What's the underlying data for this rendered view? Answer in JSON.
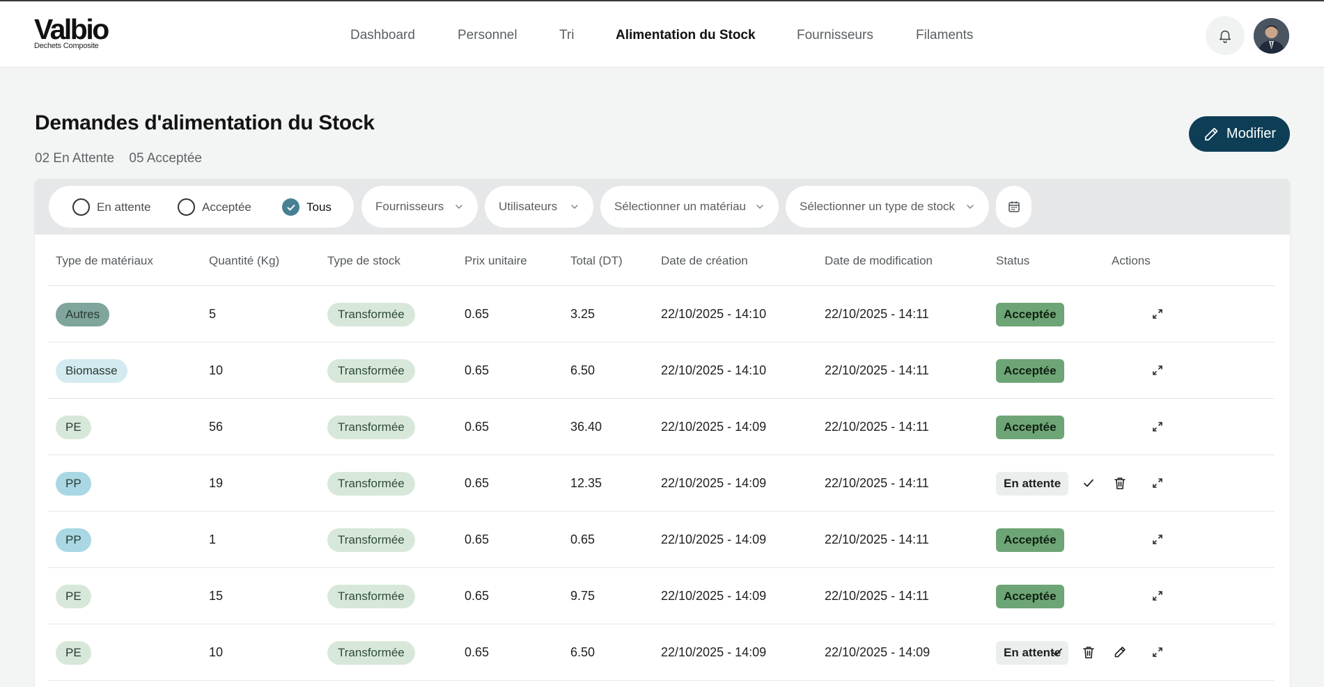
{
  "brand": {
    "name": "Valbio",
    "tagline": "Dechets Composite"
  },
  "nav": [
    {
      "label": "Dashboard",
      "active": false
    },
    {
      "label": "Personnel",
      "active": false
    },
    {
      "label": "Tri",
      "active": false
    },
    {
      "label": "Alimentation du Stock",
      "active": true
    },
    {
      "label": "Fournisseurs",
      "active": false
    },
    {
      "label": "Filaments",
      "active": false
    }
  ],
  "header_icons": {
    "notifications": "bell-icon",
    "avatar": "user-avatar"
  },
  "page": {
    "title": "Demandes d'alimentation du Stock",
    "count_pending": "02 En Attente",
    "count_accepted": "05 Acceptée",
    "modify_label": "Modifier"
  },
  "filters": {
    "status_options": [
      {
        "label": "En attente",
        "checked": false
      },
      {
        "label": "Acceptée",
        "checked": false
      },
      {
        "label": "Tous",
        "checked": true
      }
    ],
    "suppliers": "Fournisseurs",
    "users": "Utilisateurs",
    "material": "Sélectionner un matériau",
    "stock_type": "Sélectionner un type de stock",
    "date_icon": "calendar-icon"
  },
  "table": {
    "headers": [
      "Type de matériaux",
      "Quantité (Kg)",
      "Type de stock",
      "Prix unitaire",
      "Total (DT)",
      "Date de création",
      "Date de modification",
      "Status",
      "Actions"
    ],
    "rows": [
      {
        "material": "Autres",
        "qty": "5",
        "stock": "Transformée",
        "price": "0.65",
        "total": "3.25",
        "created": "22/10/2025 - 14:10",
        "modified": "22/10/2025 - 14:11",
        "status": "Acceptée",
        "actions": [
          "expand"
        ]
      },
      {
        "material": "Biomasse",
        "qty": "10",
        "stock": "Transformée",
        "price": "0.65",
        "total": "6.50",
        "created": "22/10/2025 - 14:10",
        "modified": "22/10/2025 - 14:11",
        "status": "Acceptée",
        "actions": [
          "expand"
        ]
      },
      {
        "material": "PE",
        "qty": "56",
        "stock": "Transformée",
        "price": "0.65",
        "total": "36.40",
        "created": "22/10/2025 - 14:09",
        "modified": "22/10/2025 - 14:11",
        "status": "Acceptée",
        "actions": [
          "expand"
        ]
      },
      {
        "material": "PP",
        "qty": "19",
        "stock": "Transformée",
        "price": "0.65",
        "total": "12.35",
        "created": "22/10/2025 - 14:09",
        "modified": "22/10/2025 - 14:11",
        "status": "En attente",
        "actions": [
          "approve",
          "delete",
          "expand"
        ]
      },
      {
        "material": "PP",
        "qty": "1",
        "stock": "Transformée",
        "price": "0.65",
        "total": "0.65",
        "created": "22/10/2025 - 14:09",
        "modified": "22/10/2025 - 14:11",
        "status": "Acceptée",
        "actions": [
          "expand"
        ]
      },
      {
        "material": "PE",
        "qty": "15",
        "stock": "Transformée",
        "price": "0.65",
        "total": "9.75",
        "created": "22/10/2025 - 14:09",
        "modified": "22/10/2025 - 14:11",
        "status": "Acceptée",
        "actions": [
          "expand"
        ]
      },
      {
        "material": "PE",
        "qty": "10",
        "stock": "Transformée",
        "price": "0.65",
        "total": "6.50",
        "created": "22/10/2025 - 14:09",
        "modified": "22/10/2025 - 14:09",
        "status": "En attente",
        "actions": [
          "approve",
          "delete",
          "edit",
          "expand"
        ]
      }
    ]
  },
  "colors": {
    "brand_dark": "#0e3d56",
    "accepted": "#6ea576",
    "pending": "#eceeee",
    "material_tags": {
      "Autres": "#7fa59d",
      "Biomasse": "#d3ebf0",
      "PE": "#d7e8da",
      "PP": "#a9d8e4"
    }
  }
}
